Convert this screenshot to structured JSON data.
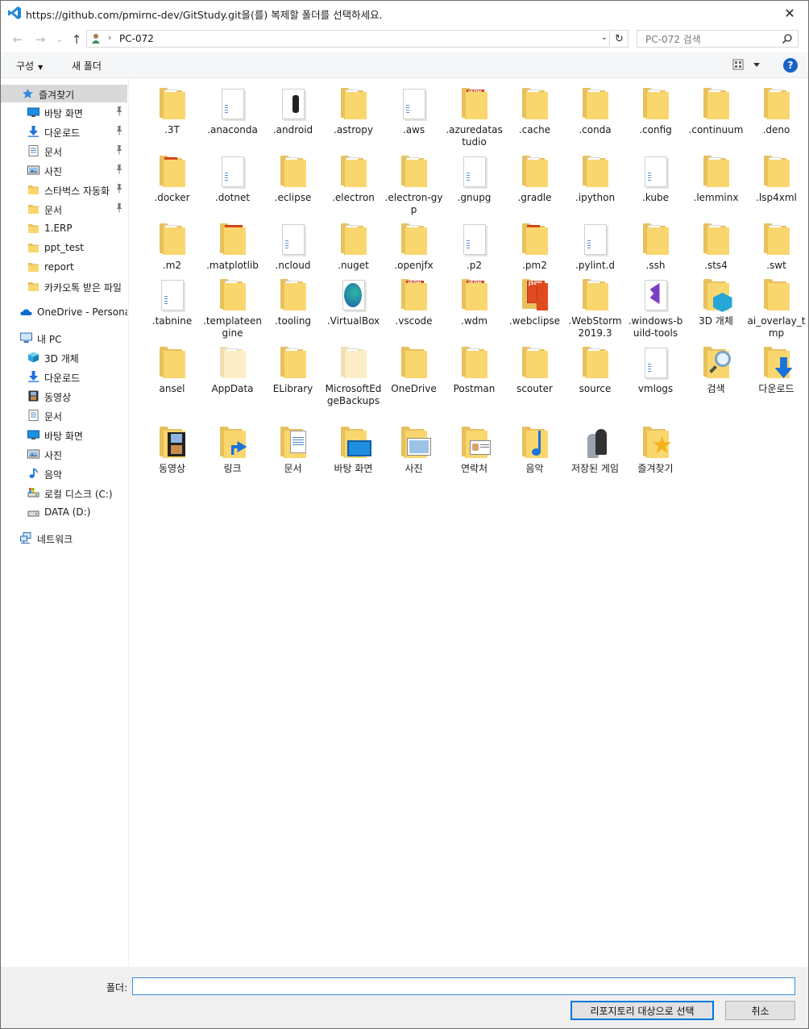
{
  "window": {
    "title": "https://github.com/pmirnc-dev/GitStudy.git을(를) 복제할 폴더를 선택하세요.",
    "close_glyph": "✕"
  },
  "address": {
    "back_glyph": "←",
    "forward_glyph": "→",
    "recent_glyph": "⌄",
    "up_glyph": "↑",
    "separator": "›",
    "crumb": "PC-072",
    "dropdown_glyph": "⌄",
    "refresh_glyph": "↻"
  },
  "search": {
    "placeholder": "PC-072 검색"
  },
  "toolbar": {
    "organize_label": "구성",
    "organize_caret": "▼",
    "new_folder_label": "새 폴더",
    "help_label": "?"
  },
  "sidebar": {
    "items": [
      {
        "label": "즐겨찾기",
        "icon": "star-icon"
      },
      {
        "label": "바탕 화면",
        "icon": "desktop-icon"
      },
      {
        "label": "다운로드",
        "icon": "download-icon"
      },
      {
        "label": "문서",
        "icon": "document-icon"
      },
      {
        "label": "사진",
        "icon": "pictures-icon"
      },
      {
        "label": "스타벅스 자동화",
        "icon": "folder-icon"
      },
      {
        "label": "문서",
        "icon": "folder-icon"
      },
      {
        "label": "1.ERP",
        "icon": "folder-icon"
      },
      {
        "label": "ppt_test",
        "icon": "folder-icon"
      },
      {
        "label": "report",
        "icon": "folder-icon"
      },
      {
        "label": "카카오톡 받은 파일",
        "icon": "folder-icon"
      },
      {
        "label": "OneDrive - Personal",
        "icon": "cloud-icon"
      },
      {
        "label": "내 PC",
        "icon": "pc-icon"
      },
      {
        "label": "3D 개체",
        "icon": "cube-3d-icon"
      },
      {
        "label": "다운로드",
        "icon": "download-icon"
      },
      {
        "label": "동영상",
        "icon": "video-icon"
      },
      {
        "label": "문서",
        "icon": "document-icon"
      },
      {
        "label": "바탕 화면",
        "icon": "desktop-icon"
      },
      {
        "label": "사진",
        "icon": "pictures-icon"
      },
      {
        "label": "음악",
        "icon": "music-icon"
      },
      {
        "label": "로컬 디스크 (C:)",
        "icon": "drive-c-icon"
      },
      {
        "label": "DATA (D:)",
        "icon": "drive-icon"
      },
      {
        "label": "네트워크",
        "icon": "network-icon"
      }
    ],
    "pin_glyph": "📌"
  },
  "folders": [
    {
      "label": ".3T",
      "kind": "folder"
    },
    {
      "label": ".anaconda",
      "kind": "doc"
    },
    {
      "label": ".android",
      "kind": "android"
    },
    {
      "label": ".astropy",
      "kind": "folder"
    },
    {
      "label": ".aws",
      "kind": "doc"
    },
    {
      "label": ".azuredatastudio",
      "kind": "json"
    },
    {
      "label": ".cache",
      "kind": "folder"
    },
    {
      "label": ".conda",
      "kind": "folder"
    },
    {
      "label": ".config",
      "kind": "folder"
    },
    {
      "label": ".continuum",
      "kind": "folder"
    },
    {
      "label": ".deno",
      "kind": "folder"
    },
    {
      "label": ".docker",
      "kind": "red"
    },
    {
      "label": ".dotnet",
      "kind": "doc"
    },
    {
      "label": ".eclipse",
      "kind": "folder"
    },
    {
      "label": ".electron",
      "kind": "folder"
    },
    {
      "label": ".electron-gyp",
      "kind": "folder"
    },
    {
      "label": ".gnupg",
      "kind": "doc"
    },
    {
      "label": ".gradle",
      "kind": "folder"
    },
    {
      "label": ".ipython",
      "kind": "folder"
    },
    {
      "label": ".kube",
      "kind": "doc"
    },
    {
      "label": ".lemminx",
      "kind": "folder"
    },
    {
      "label": ".lsp4xml",
      "kind": "folder"
    },
    {
      "label": ".m2",
      "kind": "folder"
    },
    {
      "label": ".matplotlib",
      "kind": "xml"
    },
    {
      "label": ".ncloud",
      "kind": "doc"
    },
    {
      "label": ".nuget",
      "kind": "folder"
    },
    {
      "label": ".openjfx",
      "kind": "folder"
    },
    {
      "label": ".p2",
      "kind": "doc"
    },
    {
      "label": ".pm2",
      "kind": "red"
    },
    {
      "label": ".pylint.d",
      "kind": "doc"
    },
    {
      "label": ".ssh",
      "kind": "folder"
    },
    {
      "label": ".sts4",
      "kind": "folder"
    },
    {
      "label": ".swt",
      "kind": "folder"
    },
    {
      "label": ".tabnine",
      "kind": "doc"
    },
    {
      "label": ".templateengine",
      "kind": "folder"
    },
    {
      "label": ".tooling",
      "kind": "folder"
    },
    {
      "label": ".VirtualBox",
      "kind": "vbox"
    },
    {
      "label": ".vscode",
      "kind": "json"
    },
    {
      "label": ".wdm",
      "kind": "json"
    },
    {
      "label": ".webclipse",
      "kind": "json2"
    },
    {
      "label": ".WebStorm2019.3",
      "kind": "folder"
    },
    {
      "label": ".windows-build-tools",
      "kind": "vs"
    },
    {
      "label": "3D 개체",
      "kind": "cube3d"
    },
    {
      "label": "ai_overlay_tmp",
      "kind": "plain"
    },
    {
      "label": "ansel",
      "kind": "plain"
    },
    {
      "label": "AppData",
      "kind": "ghost"
    },
    {
      "label": "ELibrary",
      "kind": "folder"
    },
    {
      "label": "MicrosoftEdgeBackups",
      "kind": "ghost"
    },
    {
      "label": "OneDrive",
      "kind": "plain"
    },
    {
      "label": "Postman",
      "kind": "folder"
    },
    {
      "label": "scouter",
      "kind": "folder"
    },
    {
      "label": "source",
      "kind": "folder"
    },
    {
      "label": "vmlogs",
      "kind": "doc"
    },
    {
      "label": "검색",
      "kind": "search"
    },
    {
      "label": "다운로드",
      "kind": "download"
    },
    {
      "label": "동영상",
      "kind": "video"
    },
    {
      "label": "링크",
      "kind": "link"
    },
    {
      "label": "문서",
      "kind": "document"
    },
    {
      "label": "바탕 화면",
      "kind": "desktop"
    },
    {
      "label": "사진",
      "kind": "pictures"
    },
    {
      "label": "연락처",
      "kind": "contacts"
    },
    {
      "label": "음악",
      "kind": "music"
    },
    {
      "label": "저장된 게임",
      "kind": "games"
    },
    {
      "label": "즐겨찾기",
      "kind": "favorites"
    }
  ],
  "footer": {
    "folder_label": "폴더:",
    "folder_value": "",
    "select_button": "리포지토리 대상으로 선택",
    "cancel_button": "취소"
  },
  "colors": {
    "accent": "#0078d7",
    "folder": "#f9d76e",
    "help": "#1763c6"
  }
}
